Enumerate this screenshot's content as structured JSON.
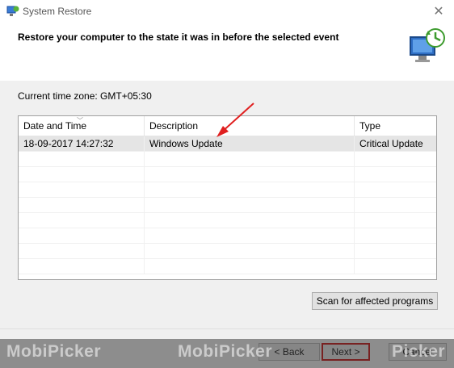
{
  "window": {
    "title": "System Restore"
  },
  "header": {
    "heading": "Restore your computer to the state it was in before the selected event"
  },
  "timezone": {
    "label": "Current time zone: GMT+05:30"
  },
  "table": {
    "columns": [
      "Date and Time",
      "Description",
      "Type"
    ],
    "rows": [
      {
        "date": "18-09-2017 14:27:32",
        "description": "Windows Update",
        "type": "Critical Update"
      }
    ]
  },
  "buttons": {
    "scan": "Scan for affected programs",
    "back": "< Back",
    "next": "Next >",
    "cancel": "Cancel"
  },
  "watermark": {
    "text1": "MobiPicker",
    "text2": "MobiPicker",
    "text3": "Picker"
  },
  "colors": {
    "annotation_red": "#e02020",
    "highlight_border": "#c00000"
  }
}
